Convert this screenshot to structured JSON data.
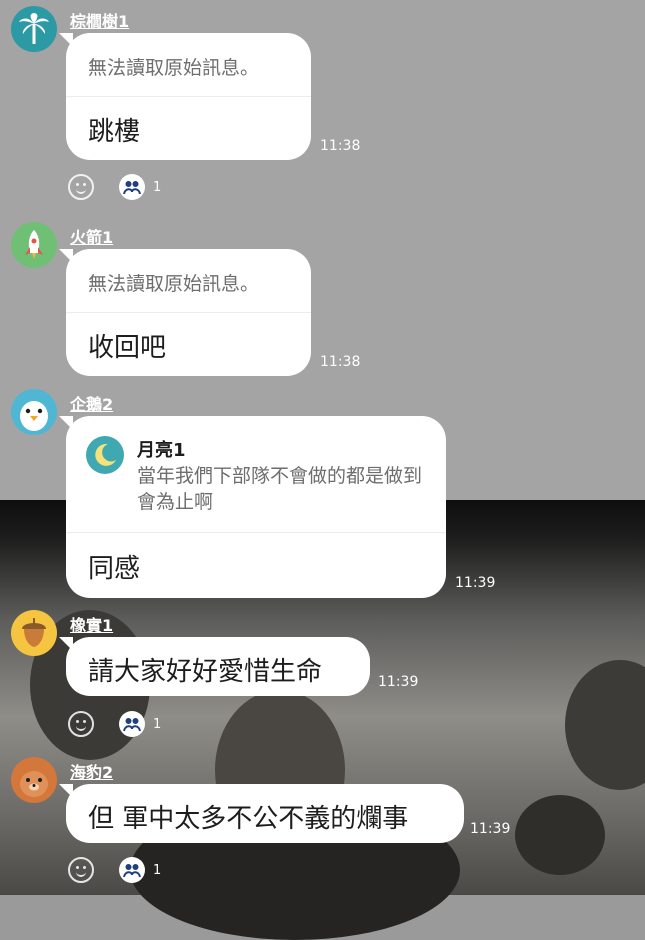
{
  "messages": [
    {
      "sender": "棕櫚樹1",
      "avatar": "palm-tree-icon",
      "notice": "無法讀取原始訊息。",
      "text": "跳樓",
      "time": "11:38",
      "reaction_count": "1"
    },
    {
      "sender": "火箭1",
      "avatar": "rocket-icon",
      "notice": "無法讀取原始訊息。",
      "text": "收回吧",
      "time": "11:38"
    },
    {
      "sender": "企鵝2",
      "avatar": "penguin-icon",
      "reply": {
        "name": "月亮1",
        "avatar": "moon-icon",
        "text": "當年我們下部隊不會做的都是做到會為止啊"
      },
      "text": "同感",
      "time": "11:39"
    },
    {
      "sender": "橡實1",
      "avatar": "acorn-icon",
      "text": "請大家好好愛惜生命",
      "time": "11:39",
      "reaction_count": "1"
    },
    {
      "sender": "海豹2",
      "avatar": "seal-icon",
      "text": "但 軍中太多不公不義的爛事",
      "time": "11:39",
      "reaction_count": "1"
    }
  ],
  "colors": {
    "bubble": "#ffffff",
    "text": "#1d1d1d",
    "muted": "#6e6e6e",
    "accent_teal": "#3fa8b1"
  }
}
